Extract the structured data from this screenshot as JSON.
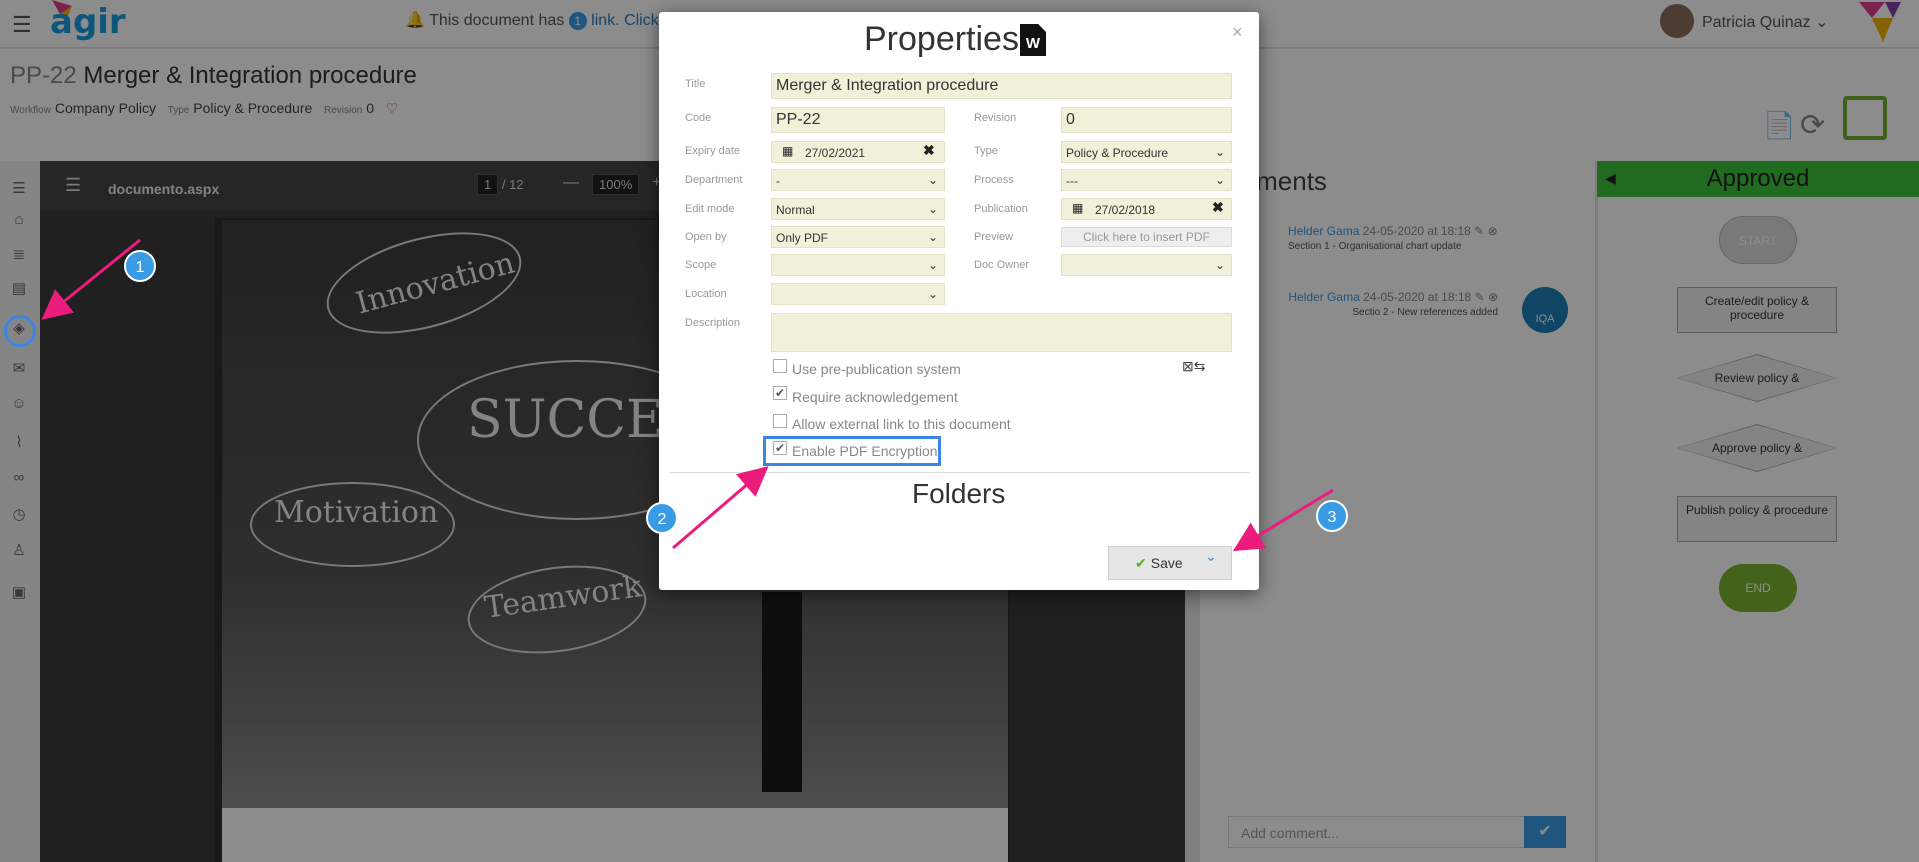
{
  "app": {
    "notice_text": "This document has",
    "notice_count": "1",
    "notice_suffix": "link. Click",
    "user_name": "Patricia Quinaz"
  },
  "document": {
    "code": "PP-22",
    "title": "Merger & Integration procedure",
    "workflow_label": "Workflow",
    "workflow_value": "Company Policy",
    "type_label": "Type",
    "type_value": "Policy & Procedure",
    "revision_label": "Revision",
    "revision_value": "0"
  },
  "viewer": {
    "filename": "documento.aspx",
    "page_current": "1",
    "page_total": "/ 12",
    "zoom": "100%",
    "image_words": [
      "Innovation",
      "SUCCES",
      "Motivation",
      "Teamwork"
    ]
  },
  "comments": {
    "title": "omments",
    "items": [
      {
        "author": "Helder Gama",
        "date": "24-05-2020 at 18:18",
        "text": "Section 1 - Organisational chart update"
      },
      {
        "author": "Helder Gama",
        "date": "24-05-2020 at 18:18",
        "text": "Sectio 2 - New references added"
      }
    ],
    "org_logo": "IQA",
    "add_placeholder": "Add comment..."
  },
  "workflow": {
    "status": "Approved",
    "nodes": {
      "start": "START",
      "create": "Create/edit policy & procedure",
      "review": "Review policy &",
      "approve": "Approve policy &",
      "publish": "Publish policy & procedure",
      "end": "END"
    }
  },
  "modal": {
    "title": "Properties",
    "word_icon_letter": "W",
    "fields": {
      "title_label": "Title",
      "title_value": "Merger & Integration procedure",
      "code_label": "Code",
      "code_value": "PP-22",
      "revision_label": "Revision",
      "revision_value": "0",
      "expiry_label": "Expiry date",
      "expiry_value": "27/02/2021",
      "type_label": "Type",
      "type_value": "Policy & Procedure",
      "department_label": "Department",
      "department_value": "-",
      "process_label": "Process",
      "process_value": "---",
      "editmode_label": "Edit mode",
      "editmode_value": "Normal",
      "publication_label": "Publication",
      "publication_value": "27/02/2018",
      "openby_label": "Open by",
      "openby_value": "Only PDF",
      "preview_label": "Preview",
      "preview_button": "Click here to insert PDF",
      "scope_label": "Scope",
      "scope_value": "",
      "docowner_label": "Doc Owner",
      "docowner_value": "",
      "location_label": "Location",
      "location_value": "",
      "description_label": "Description",
      "description_value": ""
    },
    "checkboxes": [
      {
        "label": "Use pre-publication system",
        "checked": false
      },
      {
        "label": "Require acknowledgement",
        "checked": true
      },
      {
        "label": "Allow external link to this document",
        "checked": false
      },
      {
        "label": "Enable PDF Encryption",
        "checked": true
      }
    ],
    "folders_title": "Folders",
    "save_label": "Save"
  },
  "annotations": {
    "step1": "1",
    "step2": "2",
    "step3": "3",
    "arrow_color": "#ec1c7c"
  },
  "colors": {
    "accent": "#3a9be5",
    "approved": "#3bc43b",
    "field_bg": "#f1f0d9",
    "save_green": "#70b12d"
  }
}
